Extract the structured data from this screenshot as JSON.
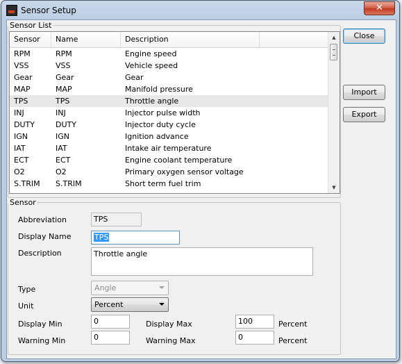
{
  "window": {
    "title": "Sensor Setup",
    "close_glyph": "✕"
  },
  "sensor_list": {
    "group_label": "Sensor List",
    "columns": [
      "Sensor",
      "Name",
      "Description"
    ],
    "rows": [
      {
        "sensor": "RPM",
        "name": "RPM",
        "description": "Engine speed"
      },
      {
        "sensor": "VSS",
        "name": "VSS",
        "description": "Vehicle speed"
      },
      {
        "sensor": "Gear",
        "name": "Gear",
        "description": "Gear"
      },
      {
        "sensor": "MAP",
        "name": "MAP",
        "description": "Manifold pressure"
      },
      {
        "sensor": "TPS",
        "name": "TPS",
        "description": "Throttle angle"
      },
      {
        "sensor": "INJ",
        "name": "INJ",
        "description": "Injector pulse width"
      },
      {
        "sensor": "DUTY",
        "name": "DUTY",
        "description": "Injector duty cycle"
      },
      {
        "sensor": "IGN",
        "name": "IGN",
        "description": "Ignition advance"
      },
      {
        "sensor": "IAT",
        "name": "IAT",
        "description": "Intake air temperature"
      },
      {
        "sensor": "ECT",
        "name": "ECT",
        "description": "Engine coolant temperature"
      },
      {
        "sensor": "O2",
        "name": "O2",
        "description": "Primary oxygen sensor voltage"
      },
      {
        "sensor": "S.TRIM",
        "name": "S.TRIM",
        "description": "Short term fuel trim"
      }
    ],
    "selected_index": 4
  },
  "buttons": {
    "close": "Close",
    "import": "Import",
    "export": "Export"
  },
  "sensor": {
    "group_label": "Sensor",
    "abbreviation_label": "Abbreviation",
    "abbreviation_value": "TPS",
    "display_name_label": "Display Name",
    "display_name_value": "TPS",
    "description_label": "Description",
    "description_value": "Throttle angle",
    "type_label": "Type",
    "type_value": "Angle",
    "unit_label": "Unit",
    "unit_value": "Percent",
    "display_min_label": "Display Min",
    "display_min_value": "0",
    "display_max_label": "Display Max",
    "display_max_value": "100",
    "display_max_unit": "Percent",
    "warning_min_label": "Warning Min",
    "warning_min_value": "0",
    "warning_max_label": "Warning Max",
    "warning_max_value": "0",
    "warning_max_unit": "Percent"
  },
  "colors": {
    "selection": "#3399ff",
    "selected_row": "#e8e8e8",
    "close_button": "#c2371e"
  }
}
